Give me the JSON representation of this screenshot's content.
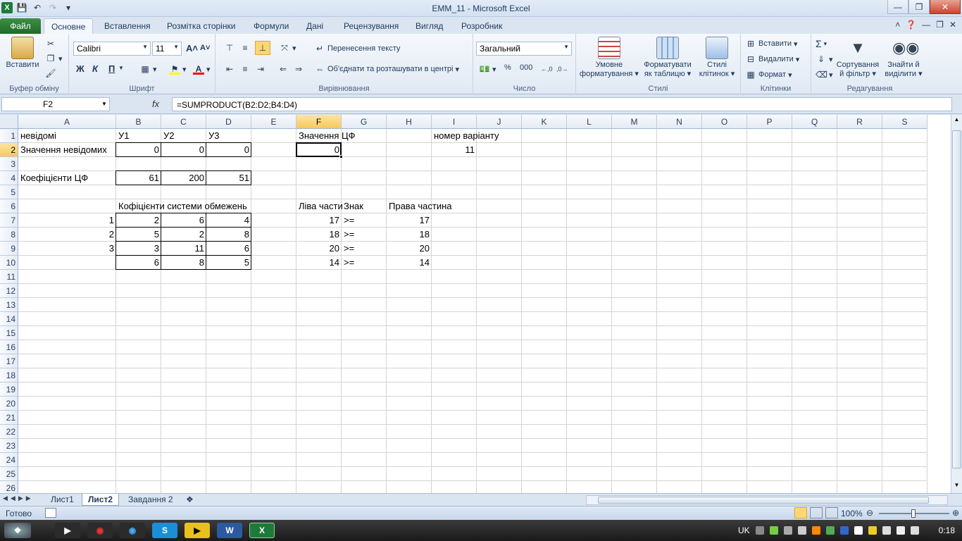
{
  "window": {
    "title": "EMM_11  -  Microsoft Excel"
  },
  "tabs": [
    "Файл",
    "Основне",
    "Вставлення",
    "Розмітка сторінки",
    "Формули",
    "Дані",
    "Рецензування",
    "Вигляд",
    "Розробник"
  ],
  "ribbon": {
    "paste": "Вставити",
    "clipboard_group": "Буфер обміну",
    "font_name": "Calibri",
    "font_size": "11",
    "bold": "Ж",
    "italic": "К",
    "underline": "П",
    "font_group": "Шрифт",
    "wrap_text": "Перенесення тексту",
    "merge_center": "Об'єднати та розташувати в центрі",
    "alignment_group": "Вирівнювання",
    "number_format": "Загальний",
    "percent": "%",
    "thousands": "000",
    "number_group": "Число",
    "conditional": [
      "Умовне",
      "форматування"
    ],
    "format_table": [
      "Форматувати",
      "як таблицю"
    ],
    "cell_styles": [
      "Стилі",
      "клітинок"
    ],
    "styles_group": "Стилі",
    "insert": "Вставити",
    "delete": "Видалити",
    "format": "Формат",
    "cells_group": "Клітинки",
    "sort_filter": [
      "Сортування",
      "й фільтр"
    ],
    "find_select": [
      "Знайти й",
      "виділити"
    ],
    "editing_group": "Редагування"
  },
  "formula_bar": {
    "name_box": "F2",
    "fx": "fx",
    "formula": "=SUMPRODUCT(B2:D2;B4:D4)"
  },
  "columns": [
    "A",
    "B",
    "C",
    "D",
    "E",
    "F",
    "G",
    "H",
    "I",
    "J",
    "K",
    "L",
    "M",
    "N",
    "O",
    "P",
    "Q",
    "R",
    "S"
  ],
  "rows": [
    "1",
    "2",
    "3",
    "4",
    "5",
    "6",
    "7",
    "8",
    "9",
    "10",
    "11",
    "12",
    "13",
    "14",
    "15",
    "16",
    "17",
    "18",
    "19",
    "20",
    "21",
    "22",
    "23",
    "24",
    "25",
    "26"
  ],
  "cells": {
    "A1": "невідомі",
    "B1": "У1",
    "C1": "У2",
    "D1": "У3",
    "F1": "Значення ЦФ",
    "I1": "номер варіанту",
    "A2": "Значення невідомих",
    "B2": "0",
    "C2": "0",
    "D2": "0",
    "F2": "0",
    "I2": "11",
    "A4": "Коефіцієнти ЦФ",
    "B4": "61",
    "C4": "200",
    "D4": "51",
    "B6": "Кофіцієнти системи обмежень",
    "F6": "Ліва части",
    "G6": "Знак",
    "H6": "Права частина",
    "A7": "1",
    "B7": "2",
    "C7": "6",
    "D7": "4",
    "F7": "17",
    "G7": ">=",
    "H7": "17",
    "A8": "2",
    "B8": "5",
    "C8": "2",
    "D8": "8",
    "F8": "18",
    "G8": ">=",
    "H8": "18",
    "A9": "3",
    "B9": "3",
    "C9": "11",
    "D9": "6",
    "F9": "20",
    "G9": ">=",
    "H9": "20",
    "B10": "6",
    "C10": "8",
    "D10": "5",
    "F10": "14",
    "G10": ">=",
    "H10": "14"
  },
  "sheets": [
    "Лист1",
    "Лист2",
    "Завдання 2"
  ],
  "status": {
    "ready": "Готово",
    "zoom": "100%"
  },
  "taskbar": {
    "lang": "UK",
    "time": "0:18"
  }
}
